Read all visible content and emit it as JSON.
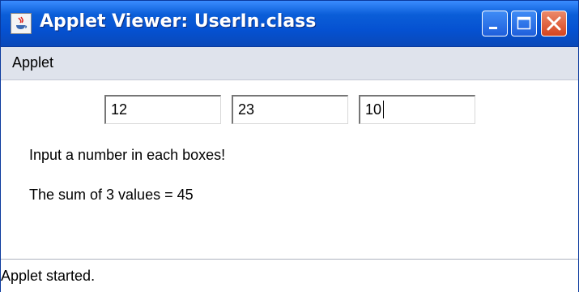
{
  "window": {
    "title": "Applet Viewer: UserIn.class",
    "icon": "java-applet-icon",
    "controls": [
      "minimize-icon",
      "maximize-icon",
      "close-icon"
    ]
  },
  "menubar": {
    "items": [
      "Applet"
    ]
  },
  "applet": {
    "fields": [
      {
        "value": "12"
      },
      {
        "value": "23"
      },
      {
        "value": "10"
      }
    ],
    "prompt": "Input a number in each boxes!",
    "result": "The sum of 3 values = 45"
  },
  "status": {
    "text": "Applet started."
  },
  "colors": {
    "titlebar_blue": "#0551d1",
    "close_red": "#d5441f",
    "menubar_bg": "#dfe3ec"
  }
}
